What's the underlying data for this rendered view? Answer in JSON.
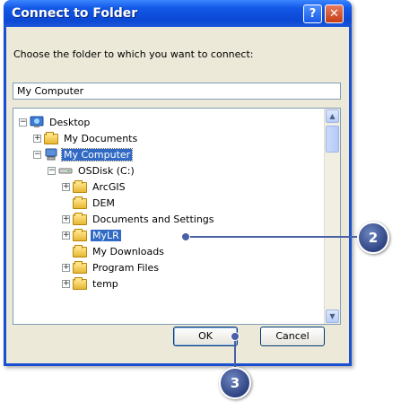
{
  "window": {
    "title": "Connect to Folder",
    "help_glyph": "?",
    "close_glyph": "✕"
  },
  "prompt": "Choose the folder to which you want to connect:",
  "path_value": "My Computer",
  "tree": {
    "desktop": "Desktop",
    "my_documents": "My Documents",
    "my_computer": "My Computer",
    "osdisk": "OSDisk (C:)",
    "arcgis": "ArcGIS",
    "dem": "DEM",
    "documents_settings": "Documents and Settings",
    "mylr": "MyLR",
    "my_downloads": "My Downloads",
    "program_files": "Program Files",
    "temp": "temp"
  },
  "buttons": {
    "ok": "OK",
    "cancel": "Cancel"
  },
  "callouts": {
    "two": "2",
    "three": "3"
  }
}
